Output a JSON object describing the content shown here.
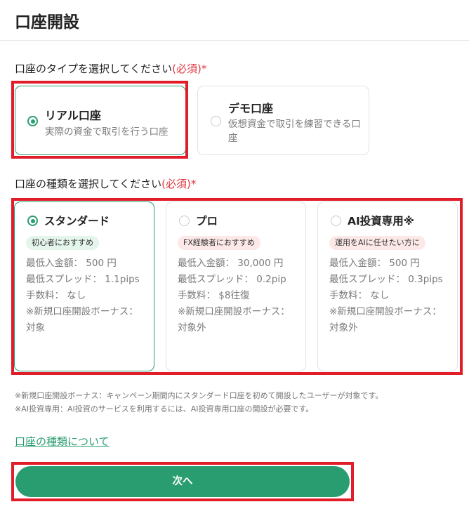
{
  "header": {
    "title": "口座開設"
  },
  "account_type": {
    "label": "口座のタイプを選択してください",
    "required": "(必須)*",
    "options": [
      {
        "title": "リアル口座",
        "desc": "実際の資金で取引を行う口座",
        "selected": true
      },
      {
        "title": "デモ口座",
        "desc": "仮想資金で取引を練習できる口座",
        "selected": false
      }
    ]
  },
  "account_kind": {
    "label": "口座の種類を選択してください",
    "required": "(必須)*",
    "plans": [
      {
        "name": "スタンダード",
        "badge": "初心者におすすめ",
        "selected": true,
        "min_deposit": "最低入金額： 500 円",
        "spread": "最低スプレッド： 1.1pips",
        "fee": "手数料： なし",
        "bonus": "※新規口座開設ボーナス： 対象"
      },
      {
        "name": "プロ",
        "badge": "FX経験者におすすめ",
        "selected": false,
        "min_deposit": "最低入金額： 30,000 円",
        "spread": "最低スプレッド： 0.2pip",
        "fee": "手数料： $8往復",
        "bonus": "※新規口座開設ボーナス： 対象外"
      },
      {
        "name": "AI投資専用※",
        "badge": "運用をAIに任せたい方に",
        "selected": false,
        "min_deposit": "最低入金額： 500 円",
        "spread": "最低スプレッド： 0.3pips",
        "fee": "手数料： なし",
        "bonus": "※新規口座開設ボーナス： 対象外"
      }
    ]
  },
  "notes": [
    "※新規口座開設ボーナス：キャンペーン期間内にスタンダード口座を初めて開設したユーザーが対象です。",
    "※AI投資専用：AI投資のサービスを利用するには、AI投資専用口座の開設が必要です。"
  ],
  "about_link": "口座の種類について",
  "next_button": "次へ",
  "colors": {
    "accent": "#2a9d70",
    "required": "#e0373f",
    "highlight_frame": "#e11d2a"
  }
}
